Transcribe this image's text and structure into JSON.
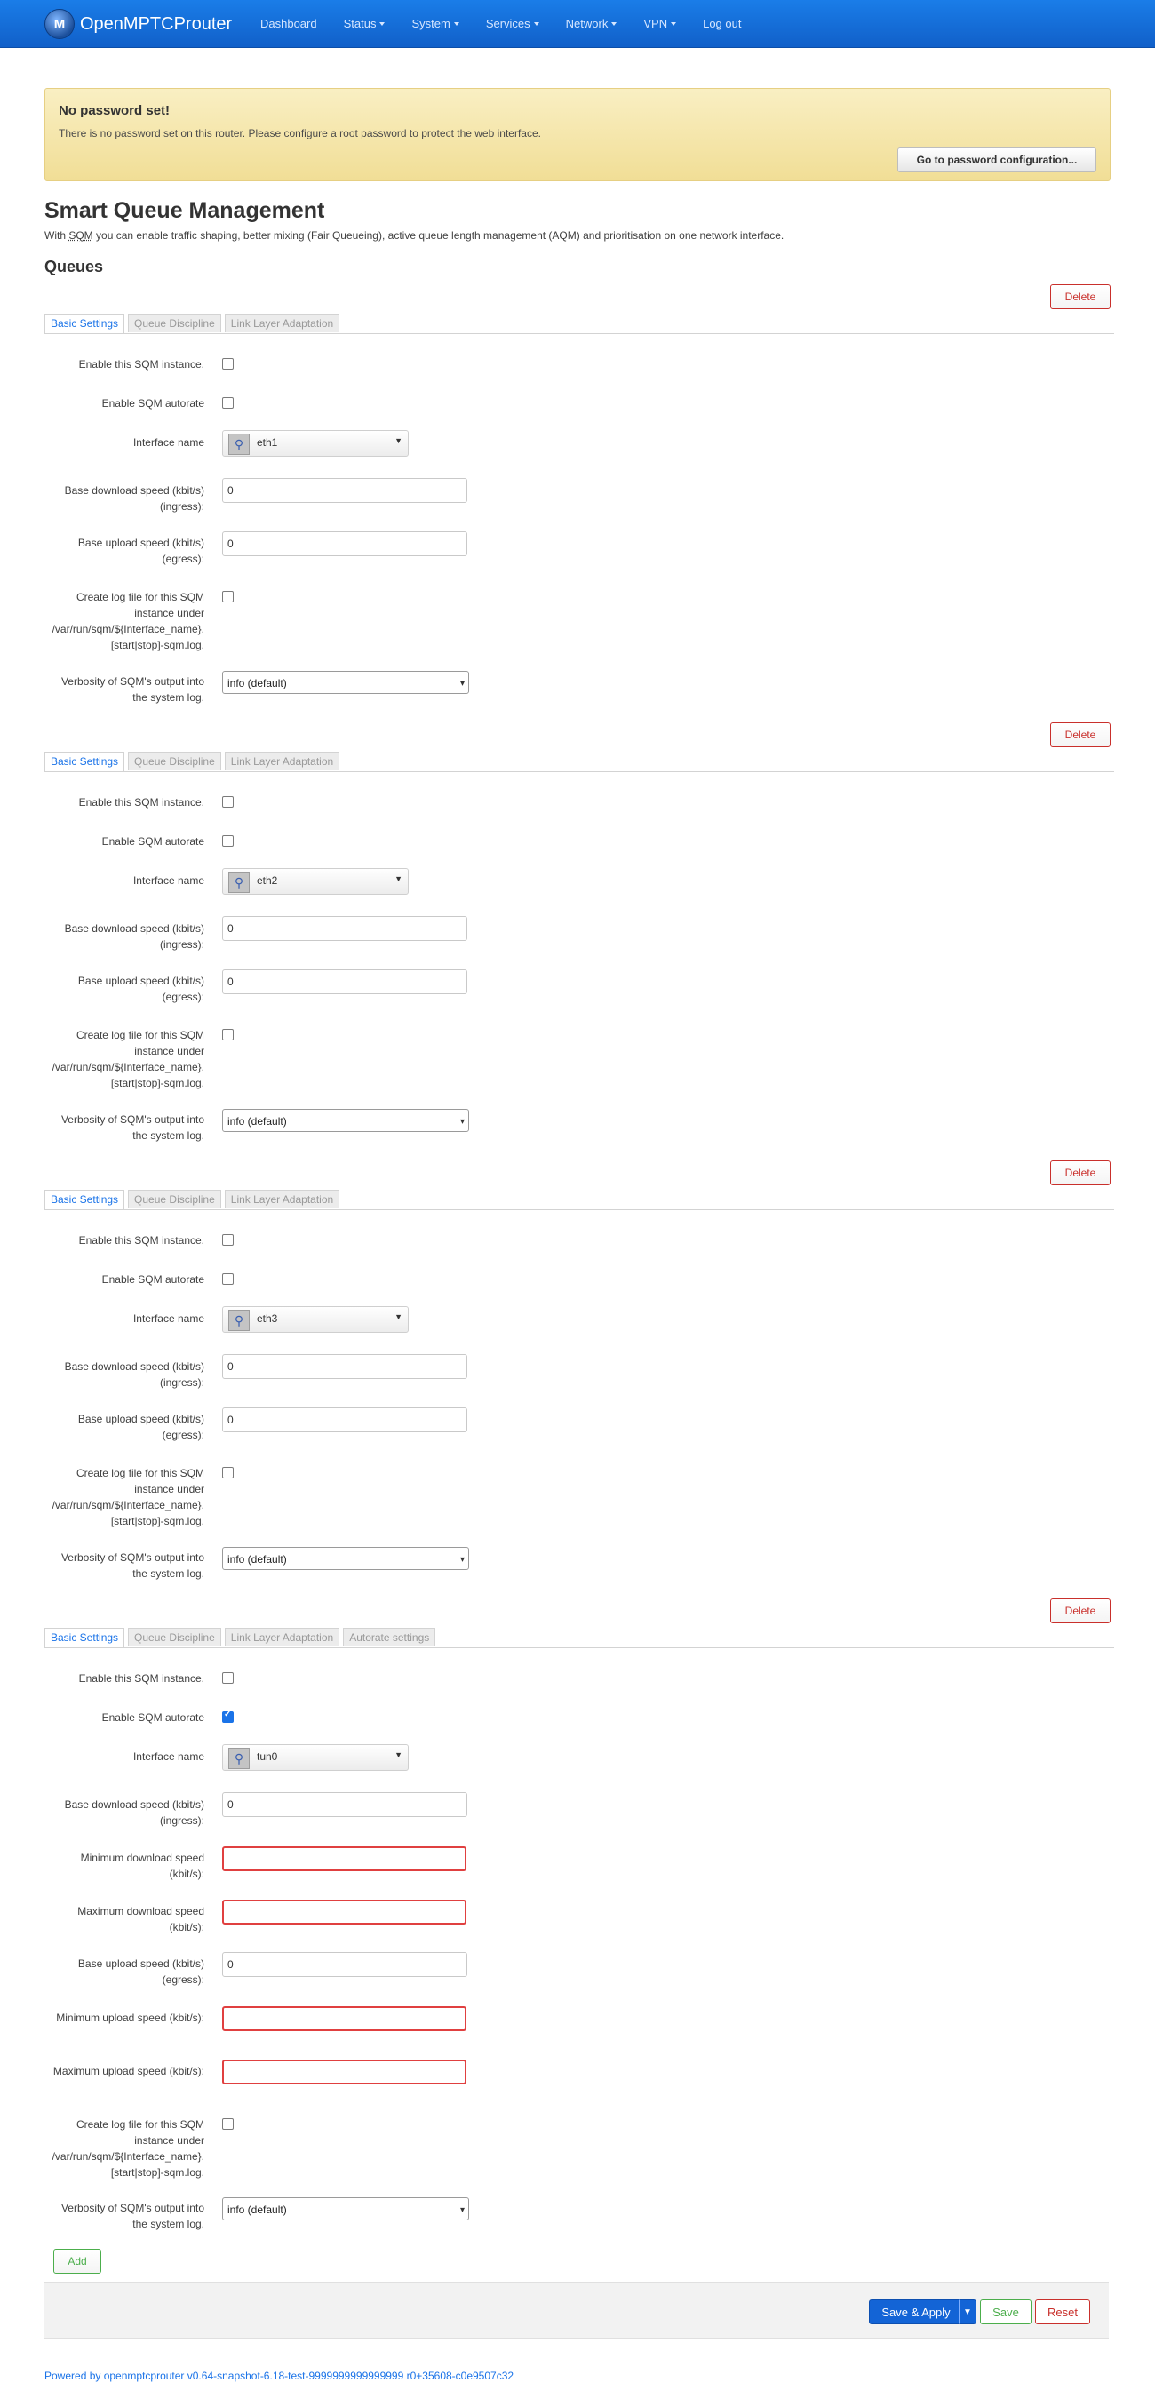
{
  "brand": {
    "name": "OpenMPTCProuter",
    "logo_text": "M"
  },
  "nav": [
    {
      "label": "Dashboard",
      "caret": false
    },
    {
      "label": "Status",
      "caret": true
    },
    {
      "label": "System",
      "caret": true
    },
    {
      "label": "Services",
      "caret": true
    },
    {
      "label": "Network",
      "caret": true
    },
    {
      "label": "VPN",
      "caret": true
    },
    {
      "label": "Log out",
      "caret": false
    }
  ],
  "alert": {
    "title": "No password set!",
    "text": "There is no password set on this router. Please configure a root password to protect the web interface.",
    "button": "Go to password configuration..."
  },
  "page": {
    "title": "Smart Queue Management",
    "desc_before": "With ",
    "desc_abbr": "SQM",
    "desc_after": " you can enable traffic shaping, better mixing (Fair Queueing), active queue length management (AQM) and prioritisation on one network interface.",
    "section_title": "Queues"
  },
  "labels": {
    "delete": "Delete",
    "enable": "Enable this SQM instance.",
    "autorate": "Enable SQM autorate",
    "interface": "Interface name",
    "download": "Base download speed (kbit/s) (ingress):",
    "upload": "Base upload speed (kbit/s) (egress):",
    "min_download": "Minimum download speed (kbit/s):",
    "max_download": "Maximum download speed (kbit/s):",
    "min_upload": "Minimum upload speed (kbit/s):",
    "max_upload": "Maximum upload speed (kbit/s):",
    "logfile": "Create log file for this SQM instance under /var/run/sqm/${Interface_name}.[start|stop]-sqm.log.",
    "verbosity": "Verbosity of SQM's output into the system log."
  },
  "tab_labels": {
    "basic": "Basic Settings",
    "qdisc": "Queue Discipline",
    "lla": "Link Layer Adaptation",
    "autorate": "Autorate settings"
  },
  "instances": [
    {
      "interface": "eth1",
      "download": "0",
      "upload": "0",
      "enabled": false,
      "autorate": false,
      "logfile": false,
      "verbosity": "info (default)"
    },
    {
      "interface": "eth2",
      "download": "0",
      "upload": "0",
      "enabled": false,
      "autorate": false,
      "logfile": false,
      "verbosity": "info (default)"
    },
    {
      "interface": "eth3",
      "download": "0",
      "upload": "0",
      "enabled": false,
      "autorate": false,
      "logfile": false,
      "verbosity": "info (default)"
    },
    {
      "interface": "tun0",
      "download": "0",
      "upload": "0",
      "enabled": false,
      "autorate": true,
      "logfile": false,
      "verbosity": "info (default)",
      "min_download": "",
      "max_download": "",
      "min_upload": "",
      "max_upload": ""
    }
  ],
  "buttons": {
    "add": "Add",
    "save_apply": "Save & Apply",
    "save": "Save",
    "reset": "Reset"
  },
  "footer": "Powered by openmptcprouter v0.64-snapshot-6.18-test-9999999999999999 r0+35608-c0e9507c32",
  "colors": {
    "accent": "#1a73e8",
    "danger": "#c9302c",
    "success": "#4cae4c",
    "navbar": "#1565d8"
  }
}
